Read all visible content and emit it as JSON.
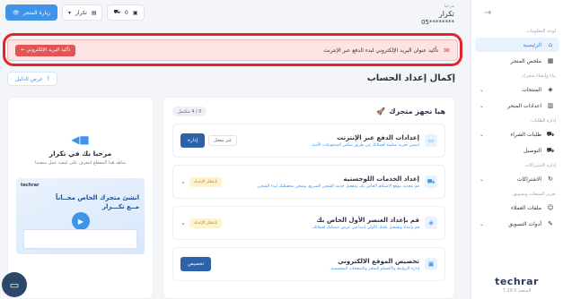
{
  "header": {
    "store_label": "مرحبا",
    "store_name": "تكرار",
    "store_phone": "05********",
    "visit_store": "زيارة المتجر",
    "language": "تكرار",
    "cart_count": "0"
  },
  "sidebar": {
    "sections": [
      {
        "title": "لوحة المعلومات",
        "items": [
          {
            "label": "الرئيسية",
            "icon": "home-icon",
            "active": true
          },
          {
            "label": "ملخص المتجر",
            "icon": "grid-icon"
          }
        ]
      },
      {
        "title": "بناء وإنشاء متجرك",
        "items": [
          {
            "label": "المنتجات",
            "icon": "box-icon",
            "chevron": true
          },
          {
            "label": "اعدادات المتجر",
            "icon": "store-icon",
            "chevron": true
          }
        ]
      },
      {
        "title": "إدارة الطلبات",
        "items": [
          {
            "label": "طلبات الشراء",
            "icon": "cart-icon",
            "chevron": true
          },
          {
            "label": "التوصيل",
            "icon": "truck-icon"
          }
        ]
      },
      {
        "title": "إدارة الاشتراكات",
        "items": [
          {
            "label": "الاشتراكات",
            "icon": "refresh-icon",
            "chevron": true
          }
        ]
      },
      {
        "title": "تعزيز المبيعات وتسويق",
        "items": [
          {
            "label": "ملفات العملاء",
            "icon": "user-icon"
          },
          {
            "label": "أدوات التسويق",
            "icon": "megaphone-icon",
            "chevron": true
          }
        ]
      }
    ],
    "logo": "techrar",
    "version": "المنصة 7.29.0"
  },
  "alert": {
    "message": "تأكيد عنوان البريد الإلكتروني لبدء الدفع عبر الإنترنت",
    "button": "تأكيد البريد الإلكتروني ←"
  },
  "page": {
    "title": "إكمال إعداد الحساب",
    "guide_button": "عرض الدليل"
  },
  "setup": {
    "title": "هيا نجهز متجرك",
    "progress": "0 / 4 مكتمل",
    "steps": [
      {
        "title": "إعدادات الدفع عبر الإنترنت",
        "desc": "اضمن تجربة سلسة لعملائك عن طريق تمكين المدفوعات الآمنة.",
        "icon": "card-icon",
        "secondary": "غير مفعل",
        "primary": "إدارة"
      },
      {
        "title": "إعداد الخدمات اللوجستية",
        "desc": "قم بتحديد موقع الاستلام الخاص بك، وتفعيل خدمة الشحن السريع، وشحن محفظتك لبدء الشحن.",
        "icon": "truck-icon",
        "badge": "بانتظار الإعداد"
      },
      {
        "title": "قم بإعداد العنصر الأول الخاص بك",
        "desc": "قم بإعداد وتشغيل باقتك الأولى لتبدأ في عرض خدماتك لعملائك.",
        "icon": "box-icon",
        "badge": "بانتظار الإعداد"
      },
      {
        "title": "تخصيص الموقع الالكتروني",
        "desc": "إدارة الروابط والأقسام المتجر والصفحات المخصصة.",
        "icon": "browser-icon",
        "primary": "تخصيص"
      }
    ]
  },
  "welcome": {
    "title": "مرحبا بك في تكرار",
    "subtitle": "شاهد هذا المقطع لتتعرف على كيفية عمل منصتنا",
    "video_logo": "techrar",
    "video_headline_1": "انشئ متجرك الخاص مجــاناً",
    "video_headline_2": "مــع تكـــرار"
  },
  "colors": {
    "accent": "#3f93e8",
    "alert_bg": "#fde3e3",
    "alert_button": "#e25555",
    "highlight_ring": "#e0262b",
    "primary_button": "#2c62a8"
  }
}
